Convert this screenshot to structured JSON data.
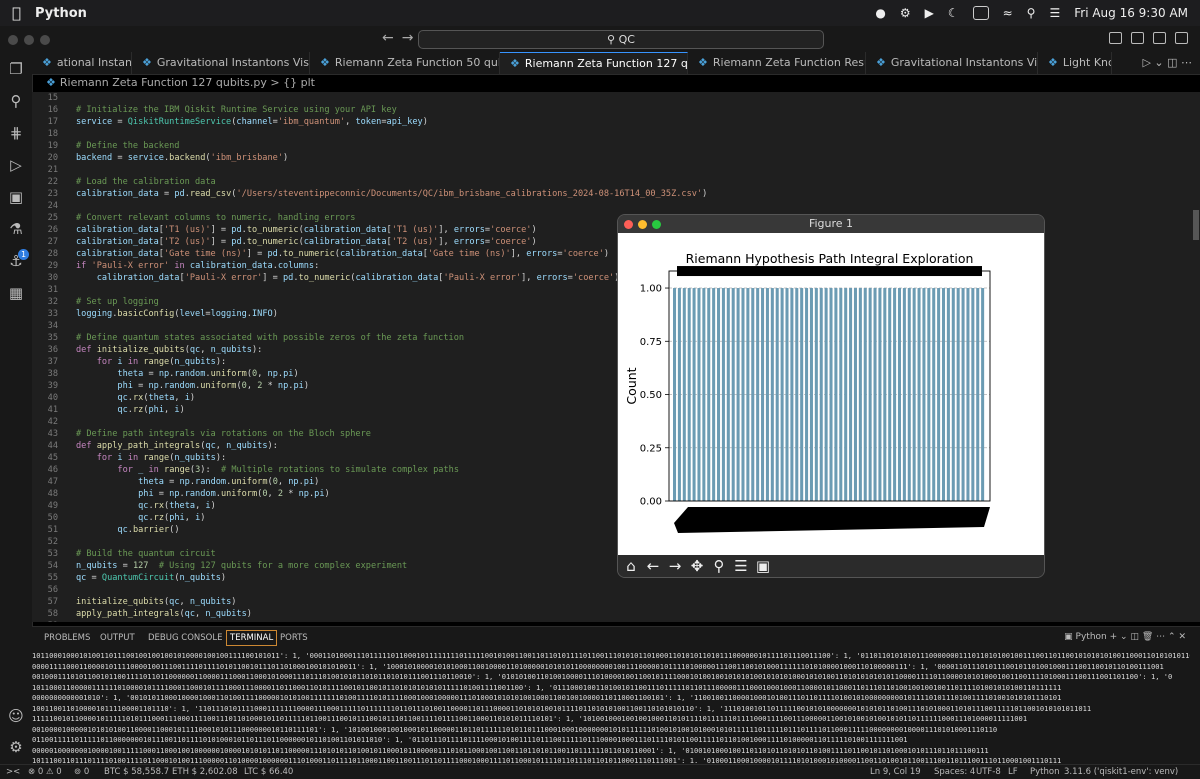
{
  "menubar": {
    "app_name": "Python",
    "datetime": "Fri Aug 16  9:30 AM"
  },
  "titlebar": {
    "search_text": "QC"
  },
  "tabs": [
    {
      "label": "ational Instantons.py",
      "active": false
    },
    {
      "label": "Gravitational Instantons Visuals.py",
      "active": false
    },
    {
      "label": "Riemann Zeta Function 50 qubits.py",
      "active": false
    },
    {
      "label": "Riemann Zeta Function 127 qubits.py",
      "active": true
    },
    {
      "label": "Riemann Zeta Function Results.py",
      "active": false
    },
    {
      "label": "Gravitational Instantons Visuals2.py",
      "active": false
    },
    {
      "label": "Light Knot.py",
      "active": false
    }
  ],
  "breadcrumb": {
    "file": "Riemann Zeta Function 127 qubits.py",
    "symbol": "{} plt"
  },
  "activity_badge": "1",
  "code_lines": [
    {
      "n": "15",
      "t": ""
    },
    {
      "n": "16",
      "t": "# Initialize the IBM Qiskit Runtime Service using your API key"
    },
    {
      "n": "17",
      "t": "service = QiskitRuntimeService(channel='ibm_quantum', token=api_key)"
    },
    {
      "n": "18",
      "t": ""
    },
    {
      "n": "19",
      "t": "# Define the backend"
    },
    {
      "n": "20",
      "t": "backend = service.backend('ibm_brisbane')"
    },
    {
      "n": "21",
      "t": ""
    },
    {
      "n": "22",
      "t": "# Load the calibration data"
    },
    {
      "n": "23",
      "t": "calibration_data = pd.read_csv('/Users/steventippeconnic/Documents/QC/ibm_brisbane_calibrations_2024-08-16T14_00_35Z.csv')"
    },
    {
      "n": "24",
      "t": ""
    },
    {
      "n": "25",
      "t": "# Convert relevant columns to numeric, handling errors"
    },
    {
      "n": "26",
      "t": "calibration_data['T1 (us)'] = pd.to_numeric(calibration_data['T1 (us)'], errors='coerce')"
    },
    {
      "n": "27",
      "t": "calibration_data['T2 (us)'] = pd.to_numeric(calibration_data['T2 (us)'], errors='coerce')"
    },
    {
      "n": "28",
      "t": "calibration_data['Gate time (ns)'] = pd.to_numeric(calibration_data['Gate time (ns)'], errors='coerce')"
    },
    {
      "n": "29",
      "t": "if 'Pauli-X error' in calibration_data.columns:"
    },
    {
      "n": "30",
      "t": "    calibration_data['Pauli-X error'] = pd.to_numeric(calibration_data['Pauli-X error'], errors='coerce')"
    },
    {
      "n": "31",
      "t": ""
    },
    {
      "n": "32",
      "t": "# Set up logging"
    },
    {
      "n": "33",
      "t": "logging.basicConfig(level=logging.INFO)"
    },
    {
      "n": "34",
      "t": ""
    },
    {
      "n": "35",
      "t": "# Define quantum states associated with possible zeros of the zeta function"
    },
    {
      "n": "36",
      "t": "def initialize_qubits(qc, n_qubits):"
    },
    {
      "n": "37",
      "t": "    for i in range(n_qubits):"
    },
    {
      "n": "38",
      "t": "        theta = np.random.uniform(0, np.pi)"
    },
    {
      "n": "39",
      "t": "        phi = np.random.uniform(0, 2 * np.pi)"
    },
    {
      "n": "40",
      "t": "        qc.rx(theta, i)"
    },
    {
      "n": "41",
      "t": "        qc.rz(phi, i)"
    },
    {
      "n": "42",
      "t": ""
    },
    {
      "n": "43",
      "t": "# Define path integrals via rotations on the Bloch sphere"
    },
    {
      "n": "44",
      "t": "def apply_path_integrals(qc, n_qubits):"
    },
    {
      "n": "45",
      "t": "    for i in range(n_qubits):"
    },
    {
      "n": "46",
      "t": "        for _ in range(3):  # Multiple rotations to simulate complex paths"
    },
    {
      "n": "47",
      "t": "            theta = np.random.uniform(0, np.pi)"
    },
    {
      "n": "48",
      "t": "            phi = np.random.uniform(0, 2 * np.pi)"
    },
    {
      "n": "49",
      "t": "            qc.rx(theta, i)"
    },
    {
      "n": "50",
      "t": "            qc.rz(phi, i)"
    },
    {
      "n": "51",
      "t": "        qc.barrier()"
    },
    {
      "n": "52",
      "t": ""
    },
    {
      "n": "53",
      "t": "# Build the quantum circuit"
    },
    {
      "n": "54",
      "t": "n_qubits = 127  # Using 127 qubits for a more complex experiment"
    },
    {
      "n": "55",
      "t": "qc = QuantumCircuit(n_qubits)"
    },
    {
      "n": "56",
      "t": ""
    },
    {
      "n": "57",
      "t": "initialize_qubits(qc, n_qubits)"
    },
    {
      "n": "58",
      "t": "apply_path_integrals(qc, n_qubits)"
    },
    {
      "n": "59",
      "t": ""
    }
  ],
  "figure": {
    "window_title": "Figure 1"
  },
  "chart_data": {
    "type": "bar",
    "title": "Riemann Hypothesis Path Integral Exploration",
    "xlabel": "",
    "ylabel": "Count",
    "ylim": [
      0,
      1.08
    ],
    "yticks": [
      "0.00",
      "0.25",
      "0.50",
      "0.75",
      "1.00"
    ],
    "n_bars": 64,
    "bar_value": 1,
    "bar_color": "#6b9bb3",
    "grid": "y-dashed",
    "values": [
      1,
      1,
      1,
      1,
      1,
      1,
      1,
      1,
      1,
      1,
      1,
      1,
      1,
      1,
      1,
      1,
      1,
      1,
      1,
      1,
      1,
      1,
      1,
      1,
      1,
      1,
      1,
      1,
      1,
      1,
      1,
      1,
      1,
      1,
      1,
      1,
      1,
      1,
      1,
      1,
      1,
      1,
      1,
      1,
      1,
      1,
      1,
      1,
      1,
      1,
      1,
      1,
      1,
      1,
      1,
      1,
      1,
      1,
      1,
      1,
      1,
      1,
      1,
      1
    ]
  },
  "panel": {
    "tabs": [
      "PROBLEMS",
      "OUTPUT",
      "DEBUG CONSOLE",
      "TERMINAL",
      "PORTS"
    ],
    "active_tab": "TERMINAL",
    "shell_label": "Python"
  },
  "terminal_lines": [
    "1011000100010100110111001001001001010000100100111100101011': 1, '00011010001110111110110001011111111011111001010011001101101011110110011101010110100011010101101011100000010111101110011100': 1, '01101101010101110000000111011010100100111001101100101010101001100011010101011010100000101010111101010111000011100101",
    "0000111100011000010111100001001110011110111101011001011101101000100101010011': 1, '10001010000101010001100100001101000001010101100000000100111000001011110100000111001100101000111111010100001000110100000111': 1, '00001101110101110010110100100011100110010110100111001",
    "0010001110101100101100111101101100000011000011100011000101000111011101001010110101101010111001110110010': 1, '01010100110100100001110100001001100101111000101001001010101001010101000101010011010101010101100001111011000010101000100110011110100011100111001101100': 1, '0",
    "1011000110000011111101000010111100011000101111000111000011011000110101111001011001011010101010101111101001111001100': 1, '01110001001101001011001110111110110111000001110001000100011000010110001101110110100100100100110111101001010100110111111",
    "0000000000001010': 1, '00101011000100001000110100111100000101010011111110100111101011110001000100000111010001010101001000110010010000110110001100101': 1, '11001001100001000101001110110111101001010000000001011110101110100111101001010101110101",
    "10011001101000010111100001101110': 1, '11011101011110001111111000011100011111011111110110111010011000011011100001101010100101111011010101001100110101010110': 1, '11101001011011111001010100000001010101101001110101000110101110011111011001010101011011",
    "11111001011000010111110101110001110001111001110110100010110111110110011100101110010111011001111011110011000110101011110101': 1, '10100100010010010001101011110111111011110001111001110000011001010010100101011011111100011101000011111001",
    "0010000100000101010100110000110001011110001010111000000010110111101': 1, '10100100010010001011000001101101111110101101110001000100000001010111111010010100101000101011111101111101110111101100011111000000001000011101010001110110",
    "0110011111011111011000000010111001101111010100010110111011000000101101001101011010': 1, '01101110111101111000101001111011100111110111000010001110111101011001111101101001000111101000001101111101001111111001",
    "00000100000001000010011111000110001001000000100001010101101100000111010101101001011000101100000111010110001001100110110101100110111111011010110001': 1, '01001010001001101101011010101101001111011001011010001010111011011100111",
    "1011100110111011110100111101100010100111000001101000010000001110100011011110110001100110011101101111000100011110110001011110110111011010110001110111001': 1, '01000110001000010111101010001010000110011010010110011100110111001110110001001110111",
    "0110010001011010101110101001000111101111010010110100110011000110110101110111001101101001110110110101110100100110010011010110001011010011110010110111101': 1, '00101000100101000011011011101101100110100100001101111101011011111111111001100110",
    "1101101010001000': 1, '10001011110100100000001101101000011000011100000011111011000001010011001110111100011010010100011110111101101010111100011111011100001011000010000101011010110100110111010010100011101': 1}"
  ],
  "statusbar": {
    "errors": "0",
    "warnings": "0",
    "ports": "0",
    "btc": "BTC $ 58,558.7",
    "eth": "ETH $ 2,602.08",
    "ltc": "LTC $ 66.40",
    "position": "Ln 9, Col 19",
    "spaces": "Spaces: 4",
    "encoding": "UTF-8",
    "eol": "LF",
    "language": "Python",
    "interpreter": "3.11.6 ('qiskit1-env': venv)"
  }
}
